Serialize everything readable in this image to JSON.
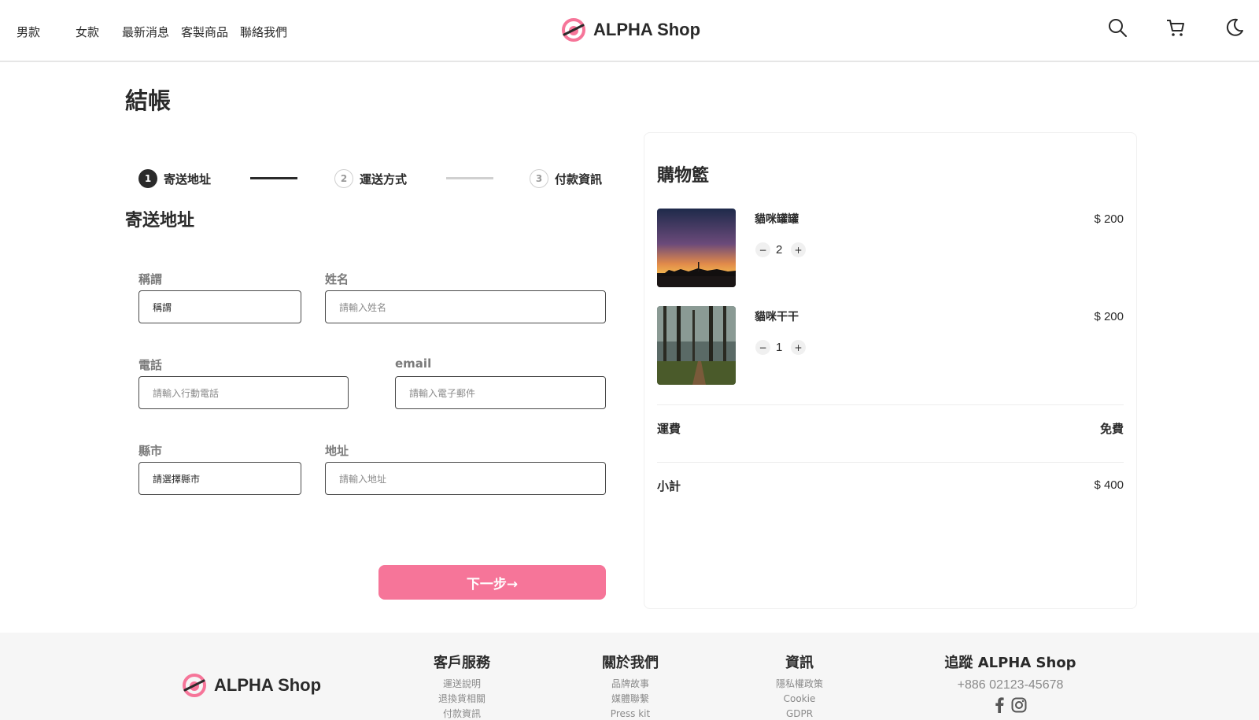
{
  "header": {
    "nav": [
      "男款",
      "女款",
      "最新消息",
      "客製商品",
      "聯絡我們"
    ],
    "brand": "ALPHA Shop",
    "icons": [
      "search-icon",
      "cart-icon",
      "moon-icon"
    ],
    "accent": "#f67599"
  },
  "page": {
    "title": "結帳",
    "steps": [
      {
        "num": "1",
        "label": "寄送地址"
      },
      {
        "num": "2",
        "label": "運送方式"
      },
      {
        "num": "3",
        "label": "付款資訊"
      }
    ],
    "section_title": "寄送地址",
    "form": {
      "salutation": {
        "label": "稱謂",
        "value": "稱謂"
      },
      "name": {
        "label": "姓名",
        "placeholder": "請輸入姓名"
      },
      "phone": {
        "label": "電話",
        "placeholder": "請輸入行動電話"
      },
      "email": {
        "label": "email",
        "placeholder": "請輸入電子郵件"
      },
      "city": {
        "label": "縣市",
        "value": "請選擇縣市"
      },
      "address": {
        "label": "地址",
        "placeholder": "請輸入地址"
      }
    },
    "next_label": "下一步→"
  },
  "cart": {
    "title": "購物籃",
    "items": [
      {
        "name": "貓咪罐罐",
        "qty": "2",
        "price": "$ 200"
      },
      {
        "name": "貓咪干干",
        "qty": "1",
        "price": "$ 200"
      }
    ],
    "shipping": {
      "label": "運費",
      "value": "免費"
    },
    "subtotal": {
      "label": "小計",
      "value": "$ 400"
    }
  },
  "footer": {
    "brand": "ALPHA Shop",
    "columns": [
      {
        "title": "客戶服務",
        "links": [
          "運送說明",
          "退換貨相關",
          "付款資訊"
        ]
      },
      {
        "title": "關於我們",
        "links": [
          "品牌故事",
          "媒體聯繫",
          "Press kit"
        ]
      },
      {
        "title": "資訊",
        "links": [
          "隱私權政策",
          "Cookie",
          "GDPR"
        ]
      }
    ],
    "follow": {
      "title": "追蹤 ALPHA Shop",
      "phone": "+886 02123-45678"
    }
  }
}
